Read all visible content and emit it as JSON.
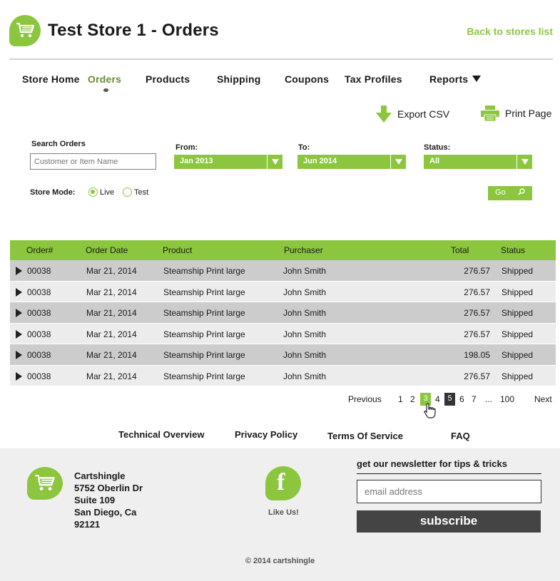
{
  "header": {
    "title": "Test Store 1 - Orders",
    "back_link": "Back to stores list"
  },
  "nav": {
    "items": [
      {
        "label": "Store Home"
      },
      {
        "label": "Orders",
        "active": true
      },
      {
        "label": "Products"
      },
      {
        "label": "Shipping"
      },
      {
        "label": "Coupons"
      },
      {
        "label": "Tax Profiles"
      },
      {
        "label": "Reports"
      }
    ]
  },
  "actions": {
    "export_csv": "Export CSV",
    "print_page": "Print Page"
  },
  "filters": {
    "search_label": "Search Orders",
    "search_placeholder": "Customer or Item Name",
    "from_label": "From:",
    "from_value": "Jan 2013",
    "to_label": "To:",
    "to_value": "Jun 2014",
    "status_label": "Status:",
    "status_value": "All",
    "store_mode_label": "Store Mode:",
    "mode_live": "Live",
    "mode_test": "Test",
    "mode_selected": "Live",
    "go_label": "Go"
  },
  "table": {
    "columns": [
      "Order#",
      "Order Date",
      "Product",
      "Purchaser",
      "Total",
      "Status"
    ],
    "rows": [
      [
        "00038",
        "Mar 21, 2014",
        "Steamship Print large",
        "John Smith",
        "276.57",
        "Shipped"
      ],
      [
        "00038",
        "Mar 21, 2014",
        "Steamship Print large",
        "John Smith",
        "276.57",
        "Shipped"
      ],
      [
        "00038",
        "Mar 21, 2014",
        "Steamship Print large",
        "John Smith",
        "276.57",
        "Shipped"
      ],
      [
        "00038",
        "Mar 21, 2014",
        "Steamship Print large",
        "John Smith",
        "276.57",
        "Shipped"
      ],
      [
        "00038",
        "Mar 21, 2014",
        "Steamship Print large",
        "John Smith",
        "198.05",
        "Shipped"
      ],
      [
        "00038",
        "Mar 21, 2014",
        "Steamship Print large",
        "John Smith",
        "276.57",
        "Shipped"
      ]
    ]
  },
  "pagination": {
    "previous": "Previous",
    "pages": [
      "1",
      "2",
      "3",
      "4",
      "5",
      "6",
      "7",
      "...",
      "100"
    ],
    "current": "3",
    "next": "Next"
  },
  "footer_links": [
    "Technical Overview",
    "Privacy Policy",
    "Terms Of Service",
    "FAQ"
  ],
  "footer": {
    "company": "Cartshingle",
    "address_line1": "5752 Oberlin Dr",
    "address_line2": "Suite 109",
    "city": "San Diego, Ca",
    "zip": "92121",
    "like_us": "Like Us!",
    "facebook_glyph": "f",
    "newsletter_title": "get our newsletter for tips & tricks",
    "email_placeholder": "email address",
    "subscribe_label": "subscribe",
    "copyright": "© 2014 cartshingle"
  },
  "colors": {
    "accent": "#8cc63f",
    "row_dark": "#cccccc",
    "row_light": "#ececec",
    "button_dark": "#444444"
  },
  "icons": [
    "cart-icon",
    "download-arrow-icon",
    "printer-icon",
    "search-icon",
    "facebook-icon",
    "hand-cursor-icon"
  ]
}
